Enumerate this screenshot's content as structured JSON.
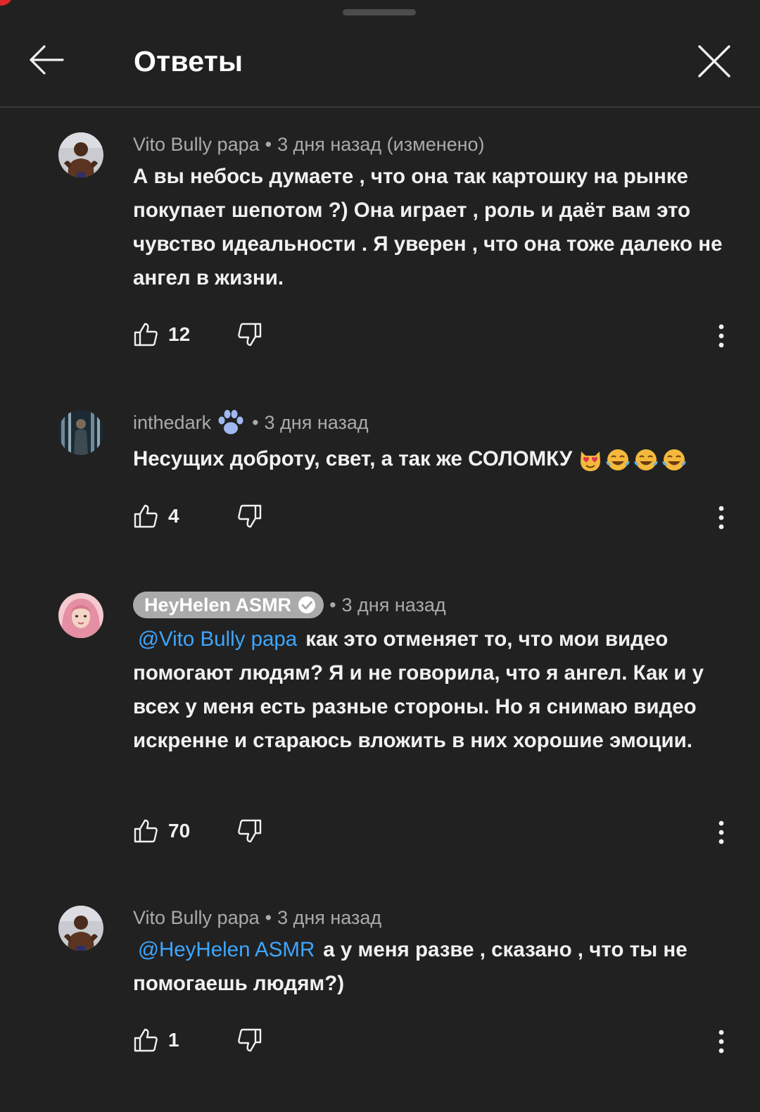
{
  "header": {
    "title": "Ответы"
  },
  "icons": {
    "back": "arrow-left-icon",
    "close": "close-icon",
    "like": "thumb-up-icon",
    "dislike": "thumb-down-icon",
    "more": "more-vert-icon",
    "verified": "verified-check-icon",
    "paw": "paw-prints-emoji",
    "heart_eyes_cat": "heart-eyes-cat-emoji",
    "tears_of_joy": "tears-of-joy-emoji"
  },
  "colors": {
    "background": "#212121",
    "text_primary": "#f1f1f1",
    "text_secondary": "#aaaaaa",
    "mention": "#3ea6ff",
    "creator_chip": "#aaaaaa"
  },
  "comments": [
    {
      "author": "Vito Bully papa",
      "separator": "•",
      "time": "3 дня назад (изменено)",
      "text": "А вы небось думаете , что она так картошку на рынке покупает шепотом ?)  Она играет ,  роль и даёт вам это чувство идеальности . Я уверен , что она тоже далеко не ангел в жизни.",
      "likes": "12"
    },
    {
      "author": "inthedark",
      "separator": "•",
      "time": "3 дня назад",
      "text": "Несущих доброту, свет, а так же СОЛОМКУ",
      "likes": "4"
    },
    {
      "author": "HeyHelen ASMR",
      "separator": "•",
      "time": "3 дня назад",
      "mention": "@Vito Bully papa",
      "text": "как это отменяет то, что мои видео помогают людям? Я и не говорила, что я ангел. Как и у всех у меня есть разные стороны. Но я снимаю видео искренне и стараюсь вложить в них хорошие эмоции.",
      "likes": "70"
    },
    {
      "author": "Vito Bully papa",
      "separator": "•",
      "time": "3 дня назад",
      "mention": "@HeyHelen ASMR",
      "text": "а у меня разве , сказано , что ты не помогаешь людям?)",
      "likes": "1"
    }
  ]
}
